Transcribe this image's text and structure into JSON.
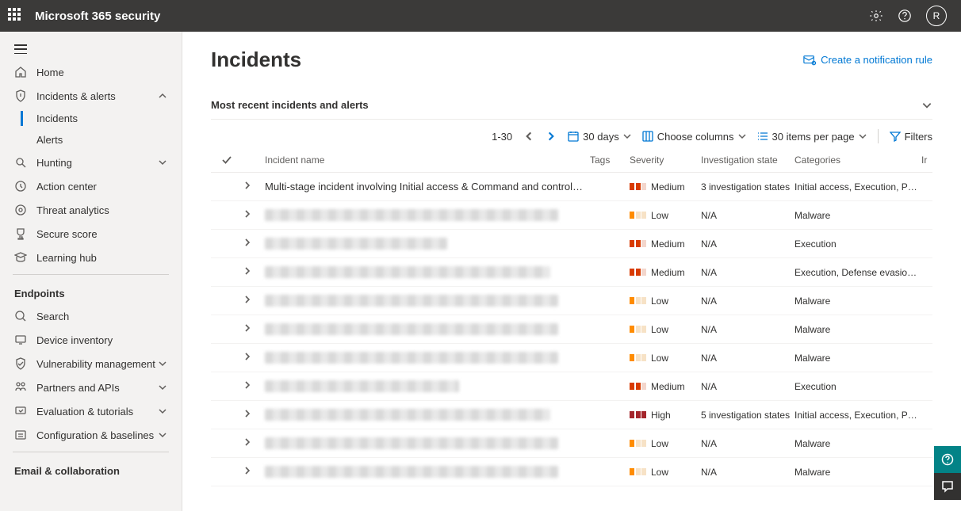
{
  "topbar": {
    "title": "Microsoft 365 security",
    "avatar_initial": "R"
  },
  "sidebar": {
    "items": [
      {
        "label": "Home"
      },
      {
        "label": "Incidents & alerts",
        "expanded": true,
        "children": [
          {
            "label": "Incidents",
            "active": true
          },
          {
            "label": "Alerts"
          }
        ]
      },
      {
        "label": "Hunting"
      },
      {
        "label": "Action center"
      },
      {
        "label": "Threat analytics"
      },
      {
        "label": "Secure score"
      },
      {
        "label": "Learning hub"
      }
    ],
    "section_endpoints": "Endpoints",
    "endpoints_items": [
      {
        "label": "Search"
      },
      {
        "label": "Device inventory"
      },
      {
        "label": "Vulnerability management"
      },
      {
        "label": "Partners and APIs"
      },
      {
        "label": "Evaluation & tutorials"
      },
      {
        "label": "Configuration & baselines"
      }
    ],
    "section_email": "Email & collaboration"
  },
  "page": {
    "title": "Incidents",
    "create_rule_label": "Create a notification rule",
    "accordion_label": "Most recent incidents and alerts"
  },
  "toolbar": {
    "range": "1-30",
    "date_label": "30 days",
    "columns_label": "Choose columns",
    "items_label": "30 items per page",
    "filters_label": "Filters"
  },
  "table": {
    "headers": {
      "incident_name": "Incident name",
      "tags": "Tags",
      "severity": "Severity",
      "investigation": "Investigation state",
      "categories": "Categories",
      "last": "Ir"
    },
    "rows": [
      {
        "name": "Multi-stage incident involving Initial access & Command and control on ...",
        "blurred": false,
        "severity": "Medium",
        "investigation": "3 investigation states",
        "categories": "Initial access, Execution, Persis..."
      },
      {
        "blurred": true,
        "blur_width": 370,
        "severity": "Low",
        "investigation": "N/A",
        "categories": "Malware"
      },
      {
        "blurred": true,
        "blur_width": 230,
        "severity": "Medium",
        "investigation": "N/A",
        "categories": "Execution"
      },
      {
        "blurred": true,
        "blur_width": 360,
        "severity": "Medium",
        "investigation": "N/A",
        "categories": "Execution, Defense evasion, D..."
      },
      {
        "blurred": true,
        "blur_width": 370,
        "severity": "Low",
        "investigation": "N/A",
        "categories": "Malware"
      },
      {
        "blurred": true,
        "blur_width": 370,
        "severity": "Low",
        "investigation": "N/A",
        "categories": "Malware"
      },
      {
        "blurred": true,
        "blur_width": 370,
        "severity": "Low",
        "investigation": "N/A",
        "categories": "Malware"
      },
      {
        "blurred": true,
        "blur_width": 245,
        "severity": "Medium",
        "investigation": "N/A",
        "categories": "Execution"
      },
      {
        "blurred": true,
        "blur_width": 360,
        "severity": "High",
        "investigation": "5 investigation states",
        "categories": "Initial access, Execution, Persis..."
      },
      {
        "blurred": true,
        "blur_width": 370,
        "severity": "Low",
        "investigation": "N/A",
        "categories": "Malware"
      },
      {
        "blurred": true,
        "blur_width": 370,
        "severity": "Low",
        "investigation": "N/A",
        "categories": "Malware"
      }
    ]
  }
}
